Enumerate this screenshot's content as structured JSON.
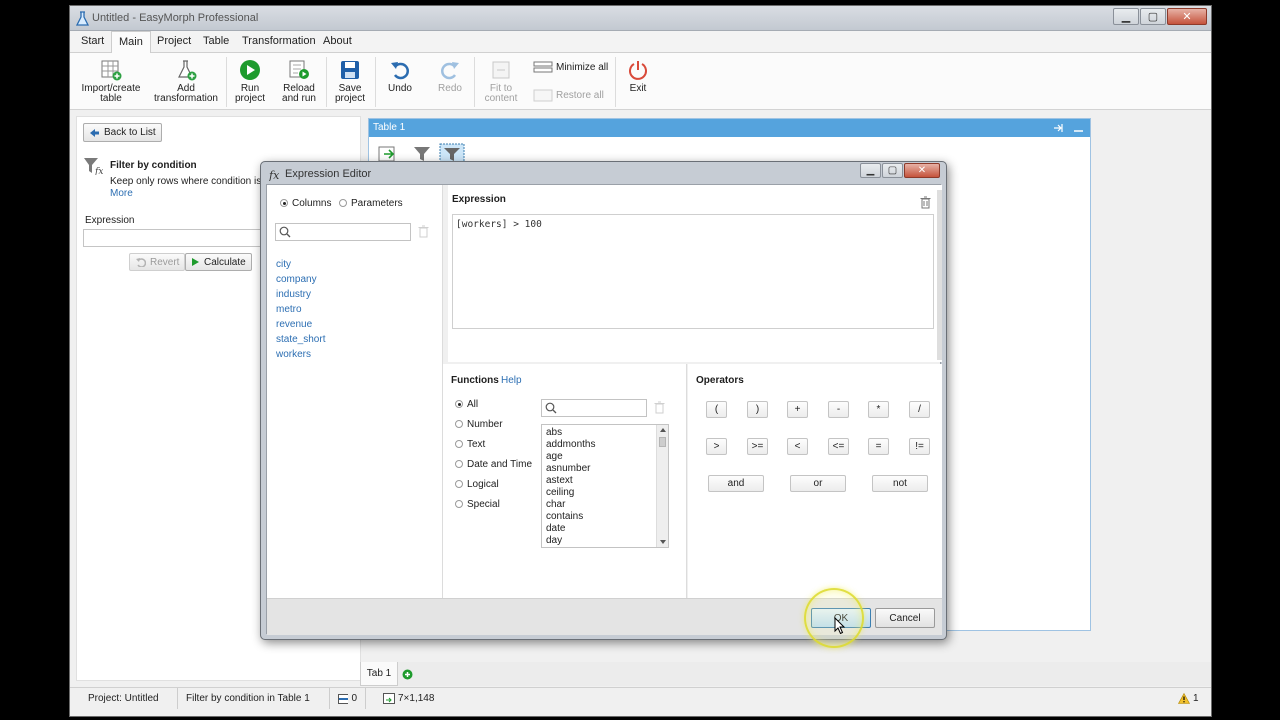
{
  "window": {
    "title": "Untitled - EasyMorph Professional",
    "controls": {
      "minimize": "▁",
      "maximize": "▢",
      "close": "✕"
    }
  },
  "menu_tabs": [
    "Start",
    "Main",
    "Project",
    "Table",
    "Transformation",
    "About"
  ],
  "ribbon": {
    "import": "Import/create table",
    "add_transformation": "Add transformation",
    "run": "Run project",
    "reload": "Reload and run",
    "save": "Save project",
    "undo": "Undo",
    "redo": "Redo",
    "fit": "Fit to content",
    "minimize_all": "Minimize all",
    "restore_all": "Restore all",
    "exit": "Exit"
  },
  "left_panel": {
    "back": "Back to List",
    "heading": "Filter by condition",
    "description": "Keep only rows where condition is s",
    "more": "More",
    "expression_label": "Expression",
    "expression_value": "",
    "revert": "Revert",
    "calculate": "Calculate"
  },
  "table_window": {
    "title": "Table 1"
  },
  "tab_bar": {
    "tab": "Tab 1"
  },
  "status_bar": {
    "project": "Project: Untitled",
    "context": "Filter by condition in Table 1",
    "rows": "0",
    "size": "7×1,148",
    "warnings": "1"
  },
  "dialog": {
    "title": "Expression Editor",
    "columns_tab": "Columns",
    "parameters_tab": "Parameters",
    "column_search": "",
    "columns": [
      "city",
      "company",
      "industry",
      "metro",
      "revenue",
      "state_short",
      "workers"
    ],
    "expression_label": "Expression",
    "expression": "[workers] > 100",
    "functions_label": "Functions",
    "help": "Help",
    "function_categories": [
      "All",
      "Number",
      "Text",
      "Date and Time",
      "Logical",
      "Special"
    ],
    "function_search": "",
    "functions": [
      "abs",
      "addmonths",
      "age",
      "asnumber",
      "astext",
      "ceiling",
      "char",
      "contains",
      "date",
      "day"
    ],
    "operators_label": "Operators",
    "operators": [
      "(",
      ")",
      "+",
      "-",
      "*",
      "/",
      ">",
      ">=",
      "<",
      "<=",
      "=",
      "!="
    ],
    "logic_operators": [
      "and",
      "or",
      "not"
    ],
    "ok": "OK",
    "cancel": "Cancel"
  },
  "colors": {
    "accent": "#55a3dd",
    "link": "#2d6fb3",
    "run_green": "#1e9b2d",
    "save_blue": "#1f5fa8",
    "exit_red": "#d94a3a"
  }
}
